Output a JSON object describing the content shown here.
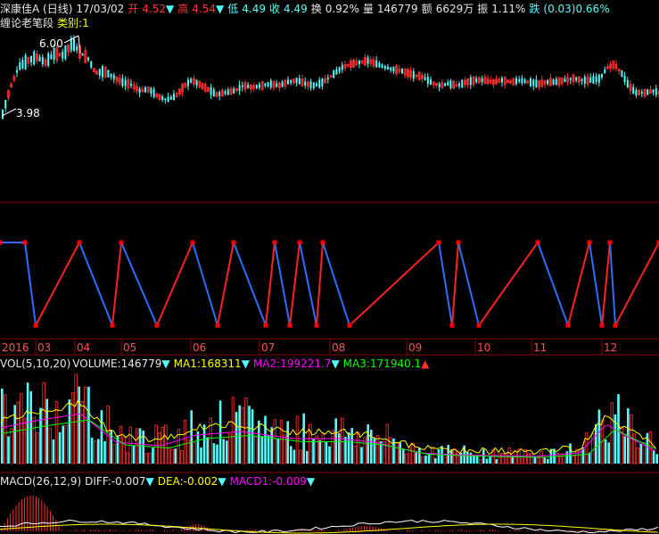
{
  "header": {
    "title": "深康佳A (日线)",
    "date": "17/03/02",
    "open_label": "开",
    "open": "4.52",
    "high_label": "高",
    "high": "4.54",
    "low_label": "低",
    "low": "4.49",
    "close_label": "收",
    "close": "4.49",
    "turnover_label": "换",
    "turnover": "0.92%",
    "volume_label": "量",
    "volume": "146779",
    "amount_label": "额",
    "amount": "6629万",
    "amplitude_label": "振",
    "amplitude": "1.11%",
    "change_label": "跌",
    "change": "(0.03)0.66%",
    "indicator_name": "缠论老笔段",
    "category_label": "类别:",
    "category_value": "1"
  },
  "price_labels": {
    "high": "6.00",
    "low": "3.98"
  },
  "x_axis": {
    "labels": [
      "2016",
      "03",
      "04",
      "05",
      "06",
      "07",
      "08",
      "09",
      "10",
      "11",
      "12"
    ]
  },
  "vol_header": {
    "name": "VOL(5,10,20)",
    "volume": "VOLUME:146779",
    "ma1": "MA1:168311",
    "ma2": "MA2:199221.7",
    "ma3": "MA3:171940.1"
  },
  "macd_header": {
    "name": "MACD(26,12,9)",
    "diff": "DIFF:-0.007",
    "dea": "DEA:-0.002",
    "macd1": "MACD1:-0.009"
  },
  "colors": {
    "background": "#000000",
    "up": "#ff3232",
    "down": "#54fcfc",
    "stroke_up": "#ff2020",
    "stroke_down": "#2a6fff",
    "pivot": "#ff0000",
    "ma1": "#ffff00",
    "ma2": "#ff00ff",
    "ma3": "#00ff00",
    "grid": "#8b0000",
    "white": "#ffffff",
    "text": "#c8c8c8"
  },
  "chart_data": [
    {
      "type": "line",
      "name": "strokes",
      "x": [
        0,
        28,
        40,
        89,
        126,
        136,
        176,
        216,
        244,
        262,
        298,
        308,
        325,
        336,
        355,
        362,
        392,
        492,
        507,
        514,
        537,
        603,
        637,
        661,
        675,
        684,
        690,
        739
      ],
      "y": [
        1,
        1,
        0,
        1,
        0,
        1,
        0,
        1,
        0,
        1,
        0,
        1,
        0,
        1,
        0,
        1,
        0,
        1,
        0,
        1,
        0,
        1,
        0,
        1,
        0,
        1,
        0,
        1
      ]
    },
    {
      "type": "bar",
      "name": "volume",
      "ylim": [
        0,
        100
      ]
    }
  ]
}
